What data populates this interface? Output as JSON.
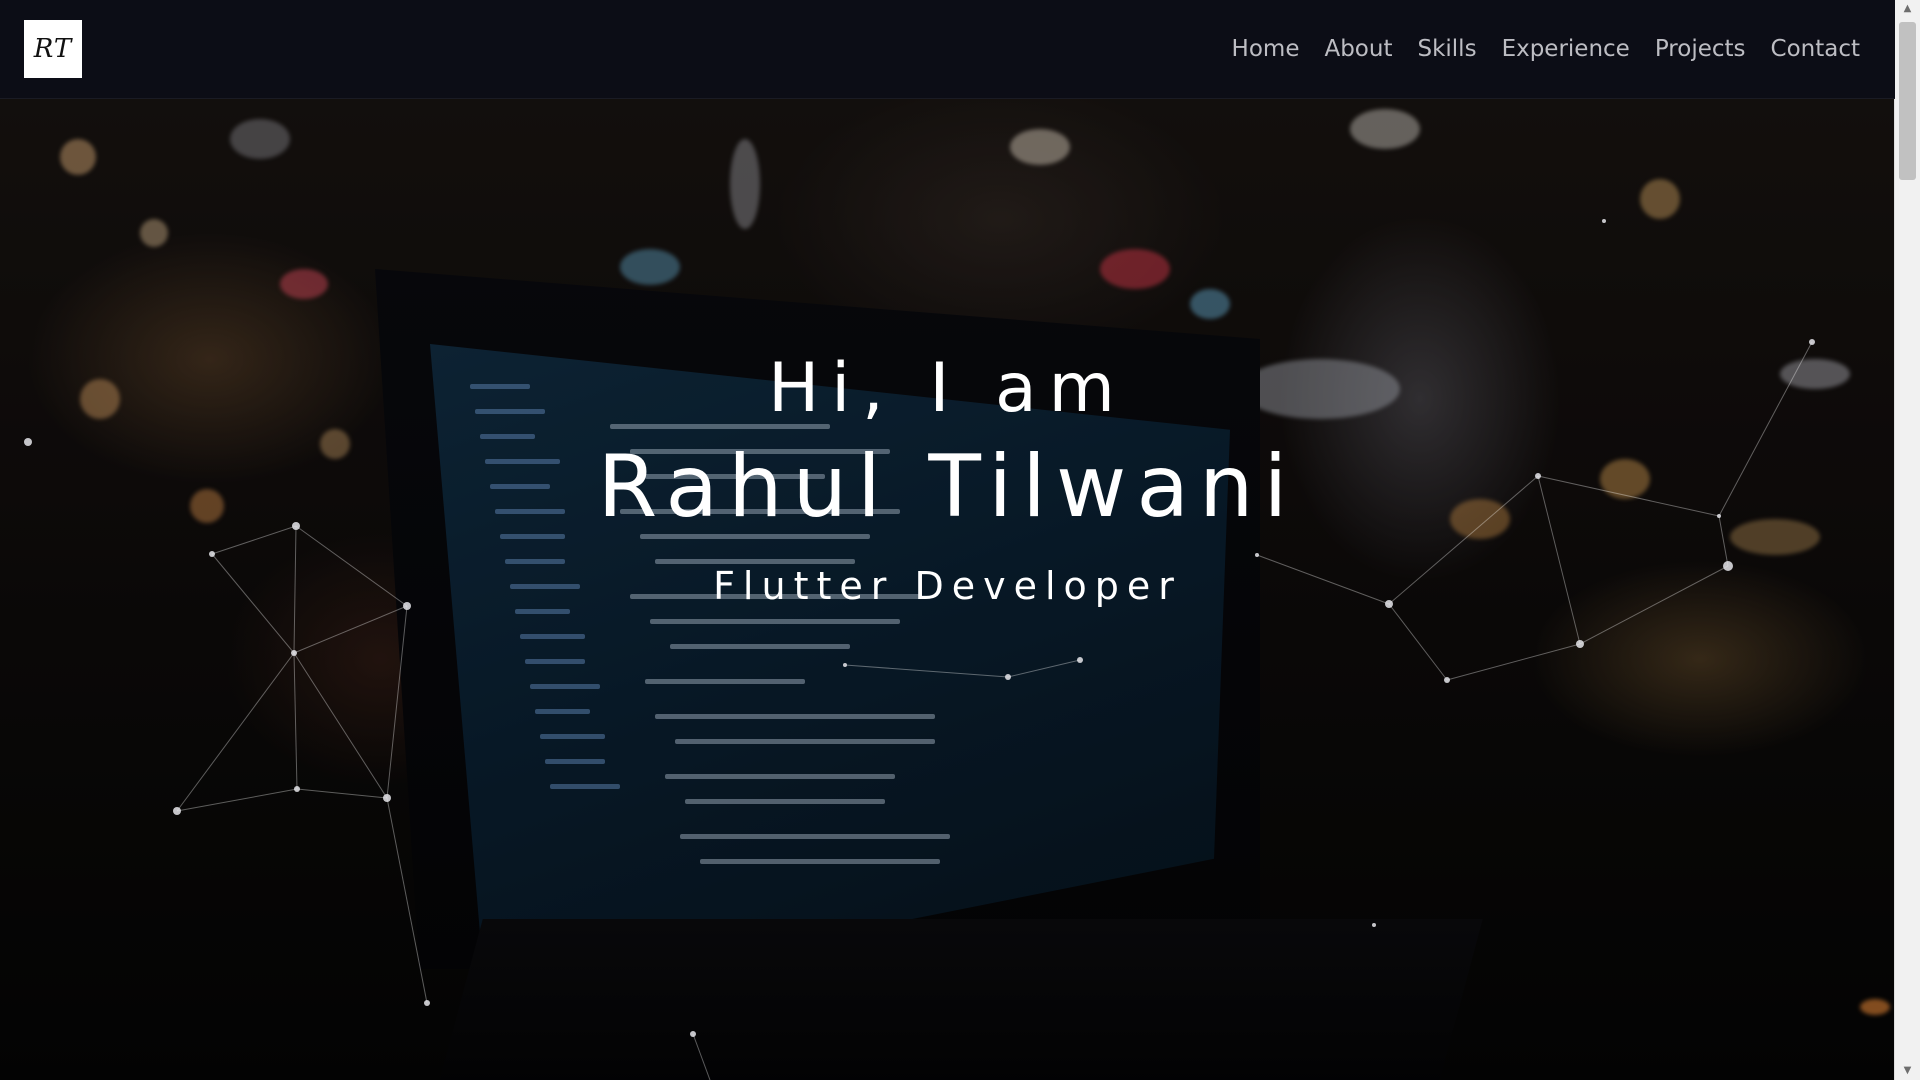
{
  "brand": {
    "logo_text": "RT"
  },
  "nav": {
    "items": [
      {
        "label": "Home"
      },
      {
        "label": "About"
      },
      {
        "label": "Skills"
      },
      {
        "label": "Experience"
      },
      {
        "label": "Projects"
      },
      {
        "label": "Contact"
      }
    ]
  },
  "hero": {
    "greeting": "Hi, I am",
    "name": "Rahul Tilwani",
    "role": "Flutter Developer"
  },
  "scrollbar": {
    "up_arrow": "▲",
    "down_arrow": "▼"
  }
}
